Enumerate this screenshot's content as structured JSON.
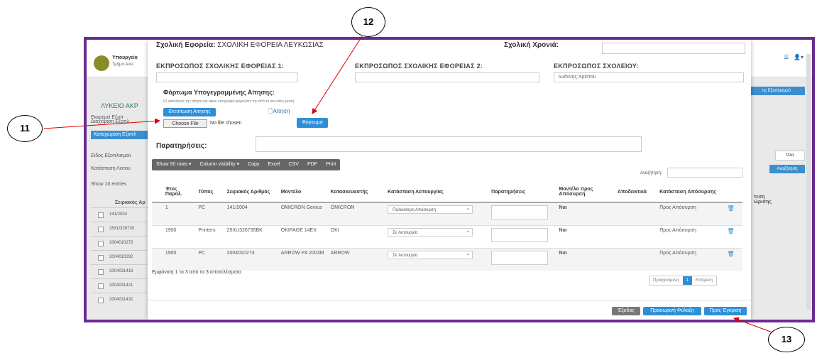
{
  "background": {
    "brand_line1": "Υπουργείο",
    "brand_line2": "Τμήμα Ανώ",
    "school": "ΛΥΚΕΙΟ ΑΚΡ",
    "status": "Εκκρεμεί Εξυπ",
    "tab1": "Διαχείριση Εξοπλ",
    "tab2": "Καταχώριση Εξοπλ",
    "field1": "Είδος Εξοπλισμού",
    "field2": "Κατάσταση Λειτου",
    "show_label": "Show",
    "show_value": "10",
    "entries_label": "entries",
    "col_header": "Σειριακός Αρ",
    "rows": [
      "141/2004",
      "25XU326730",
      "2004010273",
      "2004010292",
      "2004031419",
      "2004031421",
      "2004031432"
    ],
    "right_btn1": "ης Εξοπλισμού",
    "right_select": "Όλα",
    "right_btn2": "Αναζήτηση",
    "right_col": "τεση ώρισης"
  },
  "modal": {
    "top_label1": "Σχολική Εφορεία:",
    "top_value1": "ΣΧΟΛΙΚΗ ΕΦΟΡΕΙΑ ΛΕΥΚΩΣΙΑΣ",
    "top_label2": "Σχολική Χρονιά:",
    "rep1_label": "ΕΚΠΡΟΣΩΠΟΣ ΣΧΟΛΙΚΗΣ ΕΦΟΡΕΙΑΣ 1:",
    "rep2_label": "ΕΚΠΡΟΣΩΠΟΣ ΣΧΟΛΙΚΗΣ ΕΦΟΡΕΙΑΣ 2:",
    "rep3_label": "ΕΚΠΡΟΣΩΠΟΣ ΣΧΟΛΕΙΟΥ:",
    "rep3_value": "Ιωάννης Χρίστου",
    "upload_title": "Φόρτωμα Υπογεγραμμένης Αίτησης:",
    "upload_note": "(Ο κατάλογος την αίτηση και αφού υπογραφεί φορτώστε την από το πιο κάτω μέσο)",
    "print_btn": "Εκτύπωση Αίτησης",
    "doc_link": "Αίτηση",
    "choose_file": "Choose File",
    "no_file": "No file chosen",
    "upload_btn": "Φόρτωμα",
    "remarks_label": "Παρατηρήσεις:",
    "toolbar": [
      "Show 50 rows ▾",
      "Column visibility ▾",
      "Copy",
      "Excel",
      "CSV",
      "PDF",
      "Print"
    ],
    "search_label": "Αναζήτηση:",
    "table": {
      "headers": [
        "",
        "Έτος Παραλ.",
        "Τύπος",
        "Σειριακός Αριθμός",
        "Μοντέλο",
        "Κατασκευαστής",
        "Κατάσταση Λειτουργίας",
        "Παρατηρήσεις",
        "Μοντέλο προς Απόσυρση",
        "Αποδεικτικά",
        "Κατάσταση Απόσυρσης",
        ""
      ],
      "rows": [
        {
          "year": "1",
          "type": "PC",
          "serial": "141/2004",
          "model": "OMICRON Genius",
          "maker": "OMICRON",
          "status": "Παλαιότερη Απόσυρση",
          "withdraw": "Ναι",
          "withdraw_status": "Προς Απόσυρση"
        },
        {
          "year": "1900",
          "type": "Printers",
          "serial": "25XU326735BK",
          "model": "OKIPAGE 14EX",
          "maker": "OKI",
          "status": "Σε λειτουργία",
          "withdraw": "Ναι",
          "withdraw_status": "Προς Απόσυρση"
        },
        {
          "year": "1900",
          "type": "PC",
          "serial": "2004010273",
          "model": "ARROW P4 2003M",
          "maker": "ARROW",
          "status": "Σε λειτουργία",
          "withdraw": "Ναι",
          "withdraw_status": "Προς Απόσυρση"
        }
      ]
    },
    "info": "Εμφάνιση 1 το 3 από τα 3 αποτελέσματα",
    "pager": [
      "Προηγούμενη",
      "1",
      "Επόμενη"
    ],
    "btn_exit": "Έξοδος",
    "btn_temp_save": "Προσωρινή Φύλαξη",
    "btn_submit": "Προς Έγκριση"
  },
  "callouts": {
    "c11": "11",
    "c12": "12",
    "c13": "13"
  },
  "colors": {
    "frame": "#6a2c91",
    "primary": "#2e8fd6",
    "arrow": "#e00000"
  }
}
